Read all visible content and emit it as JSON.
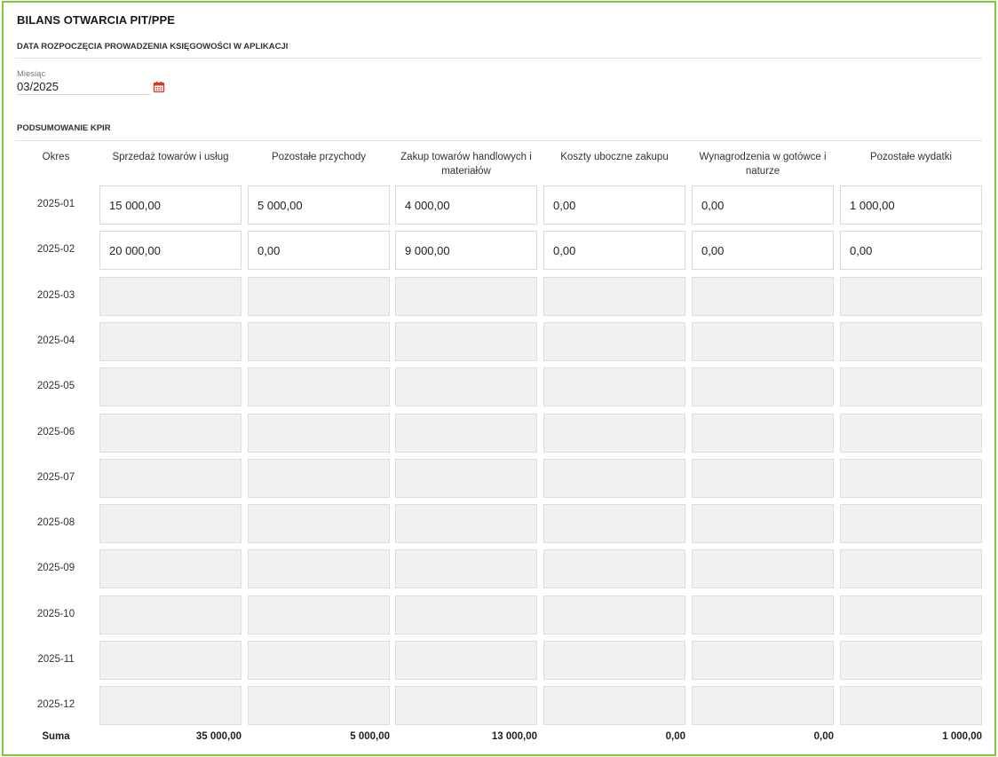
{
  "page_title": "BILANS OTWARCIA PIT/PPE",
  "section_start_label": "DATA ROZPOCZĘCIA PROWADZENIA KSIĘGOWOŚCI W APLIKACJI",
  "month_field": {
    "label": "Miesiąc",
    "value": "03/2025"
  },
  "section_summary_label": "PODSUMOWANIE KPIR",
  "table": {
    "period_header": "Okres",
    "columns": [
      "Sprzedaż towarów i usług",
      "Pozostałe przychody",
      "Zakup towarów handlowych i materiałów",
      "Koszty uboczne zakupu",
      "Wynagrodzenia w gotówce i naturze",
      "Pozostałe wydatki"
    ],
    "rows": [
      {
        "period": "2025-01",
        "values": [
          "15 000,00",
          "5 000,00",
          "4 000,00",
          "0,00",
          "0,00",
          "1 000,00"
        ],
        "editable": true
      },
      {
        "period": "2025-02",
        "values": [
          "20 000,00",
          "0,00",
          "9 000,00",
          "0,00",
          "0,00",
          "0,00"
        ],
        "editable": true
      },
      {
        "period": "2025-03",
        "values": [
          "",
          "",
          "",
          "",
          "",
          ""
        ],
        "editable": false
      },
      {
        "period": "2025-04",
        "values": [
          "",
          "",
          "",
          "",
          "",
          ""
        ],
        "editable": false
      },
      {
        "period": "2025-05",
        "values": [
          "",
          "",
          "",
          "",
          "",
          ""
        ],
        "editable": false
      },
      {
        "period": "2025-06",
        "values": [
          "",
          "",
          "",
          "",
          "",
          ""
        ],
        "editable": false
      },
      {
        "period": "2025-07",
        "values": [
          "",
          "",
          "",
          "",
          "",
          ""
        ],
        "editable": false
      },
      {
        "period": "2025-08",
        "values": [
          "",
          "",
          "",
          "",
          "",
          ""
        ],
        "editable": false
      },
      {
        "period": "2025-09",
        "values": [
          "",
          "",
          "",
          "",
          "",
          ""
        ],
        "editable": false
      },
      {
        "period": "2025-10",
        "values": [
          "",
          "",
          "",
          "",
          "",
          ""
        ],
        "editable": false
      },
      {
        "period": "2025-11",
        "values": [
          "",
          "",
          "",
          "",
          "",
          ""
        ],
        "editable": false
      },
      {
        "period": "2025-12",
        "values": [
          "",
          "",
          "",
          "",
          "",
          ""
        ],
        "editable": false
      }
    ],
    "sum_label": "Suma",
    "sums": [
      "35 000,00",
      "5 000,00",
      "13 000,00",
      "0,00",
      "0,00",
      "1 000,00"
    ]
  },
  "colors": {
    "frame_border": "#7dc63d",
    "calendar_icon": "#d23a2a",
    "disabled_cell": "#f1f1f1"
  },
  "icons": {
    "calendar": "calendar-icon"
  }
}
